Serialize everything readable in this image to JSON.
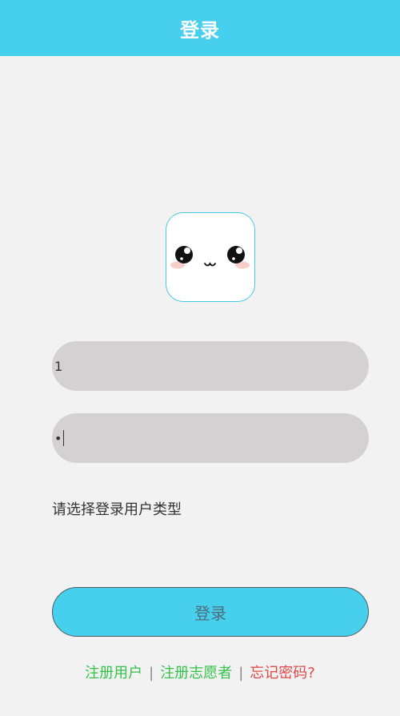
{
  "header": {
    "title": "登录"
  },
  "avatar": {
    "icon": "cute-face-icon"
  },
  "form": {
    "username_value": "1",
    "password_mask": "•",
    "user_type_label": "请选择登录用户类型",
    "login_button_label": "登录"
  },
  "footer": {
    "register_user": "注册用户",
    "register_volunteer": "注册志愿者",
    "forgot_password": "忘记密码?",
    "separator": "|"
  },
  "colors": {
    "header_bg": "#47cfee",
    "button_bg": "#47cfee",
    "link_green": "#35c14a",
    "link_red": "#e04848",
    "input_bg": "#d3d1d1"
  }
}
